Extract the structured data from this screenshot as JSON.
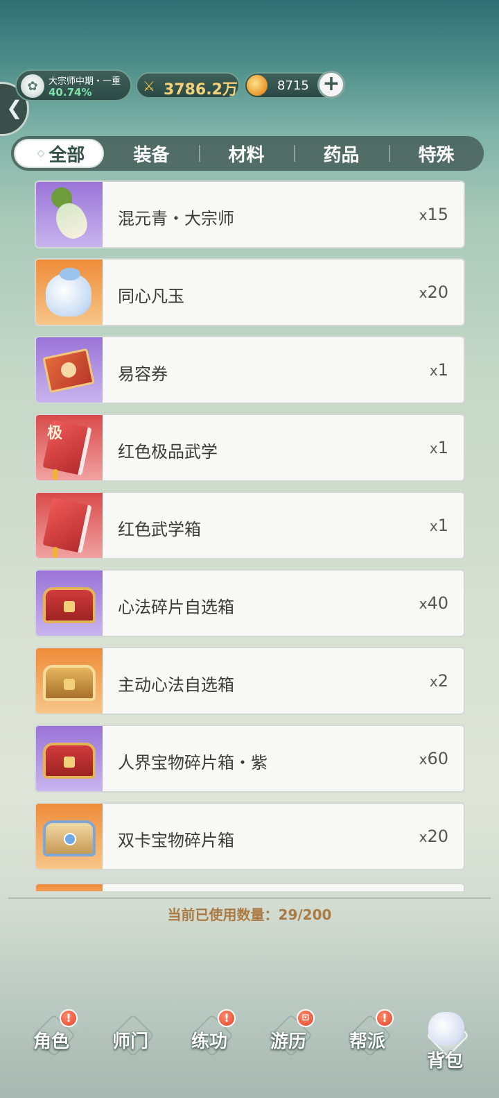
{
  "header": {
    "rank_title": "大宗师中期・一重",
    "rank_progress": "40.74%",
    "combat_power": "3786.2万",
    "coins": "8715",
    "add_label": "+"
  },
  "tabs": [
    {
      "label": "全部",
      "active": true
    },
    {
      "label": "装备",
      "active": false
    },
    {
      "label": "材料",
      "active": false
    },
    {
      "label": "药品",
      "active": false
    },
    {
      "label": "特殊",
      "active": false
    }
  ],
  "items": [
    {
      "name": "混元青・大宗师",
      "qty": "15",
      "rarity": "purple",
      "icon": "radish-icon"
    },
    {
      "name": "同心凡玉",
      "qty": "20",
      "rarity": "orange",
      "icon": "pouch-icon"
    },
    {
      "name": "易容券",
      "qty": "1",
      "rarity": "purple",
      "icon": "ticket-icon"
    },
    {
      "name": "红色极品武学",
      "qty": "1",
      "rarity": "red",
      "icon": "book-icon",
      "icon_char": "极"
    },
    {
      "name": "红色武学箱",
      "qty": "1",
      "rarity": "red",
      "icon": "book-icon"
    },
    {
      "name": "心法碎片自选箱",
      "qty": "40",
      "rarity": "purple",
      "icon": "red-chest-icon"
    },
    {
      "name": "主动心法自选箱",
      "qty": "2",
      "rarity": "orange",
      "icon": "gold-chest-icon"
    },
    {
      "name": "人界宝物碎片箱・紫",
      "qty": "60",
      "rarity": "purple",
      "icon": "red-chest-icon"
    },
    {
      "name": "双卡宝物碎片箱",
      "qty": "20",
      "rarity": "orange",
      "icon": "blue-chest-icon"
    }
  ],
  "qty_prefix": "x",
  "usage": "当前已使用数量：29/200",
  "nav": [
    {
      "label": "角色",
      "badge": "!"
    },
    {
      "label": "师门",
      "badge": ""
    },
    {
      "label": "练功",
      "badge": "!"
    },
    {
      "label": "游历",
      "badge": "⊡"
    },
    {
      "label": "帮派",
      "badge": "!"
    },
    {
      "label": "背包",
      "badge": ""
    }
  ]
}
